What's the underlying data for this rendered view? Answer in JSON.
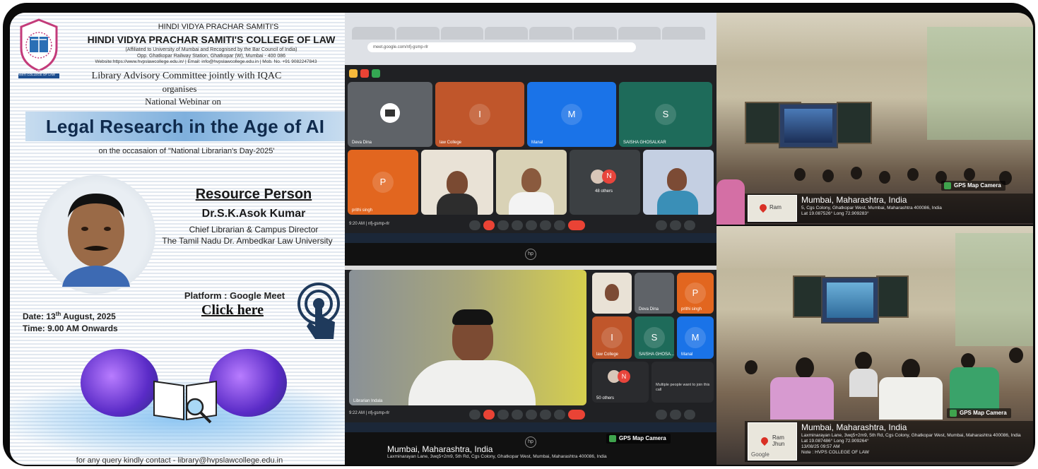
{
  "poster": {
    "header_samiti": "HINDI VIDYA PRACHAR SAMITI'S",
    "header_college": "HINDI VIDYA PRACHAR SAMITI'S COLLEGE OF LAW",
    "header_affiliation": "(Affiliated to University of Mumbai and Recognised by the Bar Council of India)",
    "header_address": "Opp. Ghatkopar Railway Station, Ghatkopar (W), Mumbai - 400 086",
    "header_contact": "Website:https://www.hvpslawcollege.edu.in/ | Email: info@hvpslawcollege.edu.in | Mob. No. +91 9082247843",
    "logo_text": "HINDI VIDYA PRACHAR SAMITI COLLEGE OF LAW",
    "organiser_line1": "Library Advisory Committee jointly with IQAC",
    "organiser_line2": "organises",
    "organiser_line3": "National Webinar on",
    "title": "Legal Research in the Age of AI",
    "occasion": "on the occasaion of \"National Librarian's Day-2025'",
    "resource_heading": "Resource Person",
    "speaker_name": "Dr.S.K.Asok Kumar",
    "speaker_role": "Chief Librarian & Campus Director",
    "speaker_university": "The Tamil Nadu Dr. Ambedkar Law University",
    "platform": "Platform : Google Meet",
    "click_here": "Click here",
    "date_label": "Date: 13",
    "date_sup": "th",
    "date_rest": " August, 2025",
    "time": "Time: 9.00 AM Onwards",
    "contact": "for any query kindly contact - library@hvpslawcollege.edu.in",
    "colors": {
      "title_band": "#7fb0dd",
      "title_text": "#0f2a4c"
    }
  },
  "meet1": {
    "tiles": [
      {
        "label": "Deva Dina",
        "initial": "",
        "color": "#5f6368"
      },
      {
        "label": "law College",
        "initial": "I",
        "color": "#c0562b"
      },
      {
        "label": "Manal",
        "initial": "M",
        "color": "#1a73e8"
      },
      {
        "label": "SAISHA GHOSALKAR",
        "initial": "S",
        "color": "#1e6b5a"
      },
      {
        "label": "prithi singh",
        "initial": "P",
        "color": "#e2661f"
      },
      {
        "label": "",
        "initial": "",
        "color": "#e9e2d6"
      },
      {
        "label": "",
        "initial": "",
        "color": "#d9d2b6"
      },
      {
        "label": "48 others",
        "initial": "N",
        "color": "#3c4043"
      },
      {
        "label": "",
        "initial": "",
        "color": "#c4cfe2"
      }
    ],
    "meeting_time": "9:20 AM | nfj-gsmp-rlr",
    "url": "meet.google.com/nfj-gsmp-rlr"
  },
  "meet2": {
    "main_label": "Librarian Indala",
    "side_tiles": [
      {
        "label": "",
        "initial": "",
        "color": "#e9e2d6"
      },
      {
        "label": "Deva Dina",
        "initial": "",
        "color": "#5f6368"
      },
      {
        "label": "prithi singh",
        "initial": "P",
        "color": "#e2661f"
      },
      {
        "label": "law College",
        "initial": "I",
        "color": "#c0562b"
      },
      {
        "label": "SAISHA GHOSA...",
        "initial": "S",
        "color": "#1e6b5a"
      },
      {
        "label": "Manal",
        "initial": "M",
        "color": "#1a73e8"
      }
    ],
    "others": "50 others",
    "notice": "Multiple people want to join this call",
    "meeting_time": "9:22 AM | nfj-gsmp-rlr",
    "hp_logo": "hp"
  },
  "locations": {
    "meet": {
      "city": "Mumbai, Maharashtra, India",
      "address": "Laxminarayan Lane, 3wq5+2m9, 5th Rd, Cgs Colony, Ghatkopar West, Mumbai, Maharashtra 400086, India",
      "badge": "GPS Map Camera"
    },
    "room1": {
      "city": "Mumbai, Maharashtra, India",
      "address": "5, Cgs Colony, Ghatkopar West, Mumbai, Maharashtra 400086, India",
      "coords": "Lat 19.087526° Long 72.909283°",
      "badge": "GPS Map Camera",
      "map_text": "Ram"
    },
    "room2": {
      "city": "Mumbai, Maharashtra, India",
      "address": "Laxminarayan Lane, 3wq5+2m9, 5th Rd, Cgs Colony, Ghatkopar West, Mumbai, Maharashtra 400086, India",
      "coords": "Lat 19.087486° Long 72.909264°",
      "datetime": "13/08/25 09:57 AM",
      "note": "Note : HVPS COLLEGE OF LAW",
      "badge": "GPS Map Camera",
      "map_text": "Ram Jhun",
      "google": "Google"
    }
  }
}
